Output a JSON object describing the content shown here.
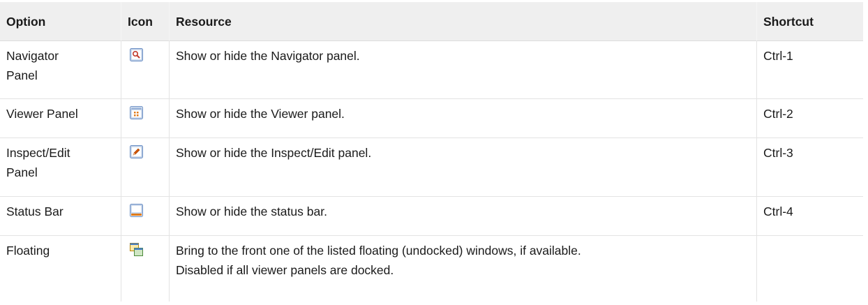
{
  "headers": {
    "option": "Option",
    "icon": "Icon",
    "resource": "Resource",
    "shortcut": "Shortcut"
  },
  "rows": [
    {
      "option_line1": "Navigator",
      "option_line2": "Panel",
      "icon": "navigator-panel-icon",
      "resource_line1": "Show or hide the Navigator panel.",
      "resource_line2": "",
      "shortcut": "Ctrl-1"
    },
    {
      "option_line1": "Viewer Panel",
      "option_line2": "",
      "icon": "viewer-panel-icon",
      "resource_line1": "Show or hide the Viewer panel.",
      "resource_line2": "",
      "shortcut": "Ctrl-2"
    },
    {
      "option_line1": "Inspect/Edit",
      "option_line2": "Panel",
      "icon": "inspect-edit-panel-icon",
      "resource_line1": "Show or hide the Inspect/Edit panel.",
      "resource_line2": "",
      "shortcut": "Ctrl-3"
    },
    {
      "option_line1": "Status Bar",
      "option_line2": "",
      "icon": "status-bar-icon",
      "resource_line1": "Show or hide the status bar.",
      "resource_line2": "",
      "shortcut": "Ctrl-4"
    },
    {
      "option_line1": "Floating",
      "option_line2": "",
      "icon": "floating-windows-icon",
      "resource_line1": "Bring to the front one of the listed floating (undocked) windows, if available.",
      "resource_line2": "Disabled if all viewer panels are docked.",
      "shortcut": ""
    }
  ]
}
